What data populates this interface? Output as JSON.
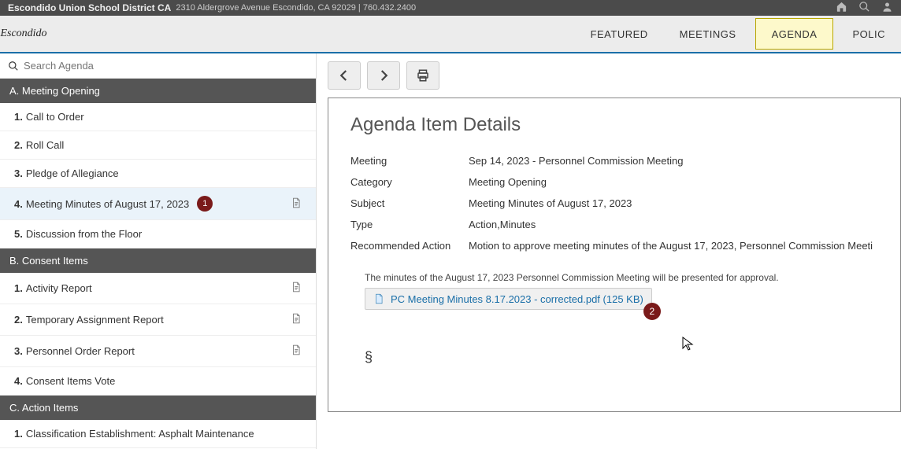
{
  "topbar": {
    "org": "Escondido Union School District CA",
    "address": "2310 Aldergrove Avenue Escondido, CA 92029 | 760.432.2400"
  },
  "logo_text": "Escondido",
  "nav": {
    "featured": "FEATURED",
    "meetings": "MEETINGS",
    "agenda": "AGENDA",
    "policies": "POLIC"
  },
  "search": {
    "placeholder": "Search Agenda"
  },
  "sections": [
    {
      "title": "A. Meeting Opening",
      "items": [
        {
          "num": "1.",
          "label": "Call to Order",
          "selected": false,
          "doc": false,
          "badge": null
        },
        {
          "num": "2.",
          "label": "Roll Call",
          "selected": false,
          "doc": false,
          "badge": null
        },
        {
          "num": "3.",
          "label": "Pledge of Allegiance",
          "selected": false,
          "doc": false,
          "badge": null
        },
        {
          "num": "4.",
          "label": "Meeting Minutes of August 17, 2023",
          "selected": true,
          "doc": true,
          "badge": "1"
        },
        {
          "num": "5.",
          "label": "Discussion from the Floor",
          "selected": false,
          "doc": false,
          "badge": null
        }
      ]
    },
    {
      "title": "B. Consent Items",
      "items": [
        {
          "num": "1.",
          "label": "Activity Report",
          "selected": false,
          "doc": true,
          "badge": null
        },
        {
          "num": "2.",
          "label": "Temporary Assignment Report",
          "selected": false,
          "doc": true,
          "badge": null
        },
        {
          "num": "3.",
          "label": "Personnel Order Report",
          "selected": false,
          "doc": true,
          "badge": null
        },
        {
          "num": "4.",
          "label": "Consent Items Vote",
          "selected": false,
          "doc": false,
          "badge": null
        }
      ]
    },
    {
      "title": "C. Action Items",
      "items": [
        {
          "num": "1.",
          "label": "Classification Establishment: Asphalt Maintenance",
          "selected": false,
          "doc": false,
          "badge": null
        }
      ]
    }
  ],
  "detail": {
    "heading": "Agenda Item Details",
    "fields": {
      "meeting_label": "Meeting",
      "meeting_val": "Sep 14, 2023 - Personnel Commission Meeting",
      "category_label": "Category",
      "category_val": "Meeting Opening",
      "subject_label": "Subject",
      "subject_val": "Meeting Minutes of August 17, 2023",
      "type_label": "Type",
      "type_val": "Action,Minutes",
      "rec_label": "Recommended Action",
      "rec_val": "Motion to approve meeting minutes of the August 17, 2023, Personnel Commission Meeti"
    },
    "attach_desc": "The minutes of the August 17, 2023 Personnel Commission Meeting will be presented for approval.",
    "attachment_name": "PC Meeting Minutes 8.17.2023 - corrected.pdf (125 KB)",
    "attachment_badge": "2",
    "section_symbol": "§"
  }
}
